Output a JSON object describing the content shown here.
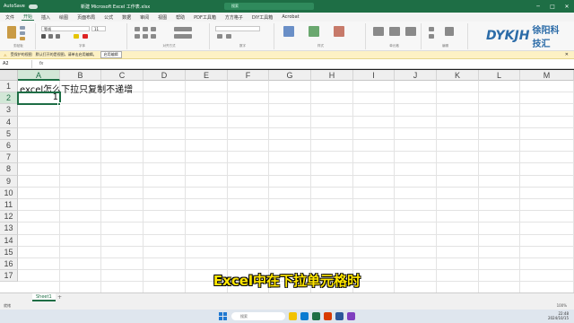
{
  "titlebar": {
    "autosave": "AutoSave",
    "doc_title": "新建 Microsoft Excel 工作表.xlsx",
    "search": "搜索",
    "minimize": "─",
    "maximize": "□",
    "close": "✕"
  },
  "menu": {
    "tabs": [
      "文件",
      "开始",
      "插入",
      "绘图",
      "页面布局",
      "公式",
      "数据",
      "审阅",
      "视图",
      "帮助",
      "PDF工具箱",
      "方方格子",
      "DIY工具箱",
      "Acrobat"
    ]
  },
  "ribbon": {
    "groups": [
      "剪贴板",
      "字体",
      "对齐方式",
      "数字",
      "样式",
      "单元格",
      "编辑"
    ],
    "font_name": "等线",
    "font_size": "11"
  },
  "logo": {
    "mark": "DYKJH",
    "text": "徐阳科技汇"
  },
  "message_bar": {
    "label": "受保护的视图",
    "text": "默认打开的是视图，请单击启用编辑。",
    "button": "启用编辑"
  },
  "formula_bar": {
    "name_box": "A2",
    "fx": "fx",
    "content": ""
  },
  "grid": {
    "columns": [
      "A",
      "B",
      "C",
      "D",
      "E",
      "F",
      "G",
      "H",
      "I",
      "J",
      "K",
      "L",
      "M"
    ],
    "rows": [
      "1",
      "2",
      "3",
      "4",
      "5",
      "6",
      "7",
      "8",
      "9",
      "10",
      "11",
      "12",
      "13",
      "14",
      "15",
      "16",
      "17"
    ],
    "cells": {
      "A1": "excel怎么下拉只复制不递增",
      "A2": "1"
    }
  },
  "subtitle": "Excel中在下拉单元格时",
  "sheets": {
    "tabs": [
      "Sheet1"
    ],
    "add": "+"
  },
  "statusbar": {
    "left": "就绪",
    "zoom": "100%"
  },
  "taskbar": {
    "search": "搜索",
    "time": "22:48",
    "date": "2024/10/15"
  }
}
